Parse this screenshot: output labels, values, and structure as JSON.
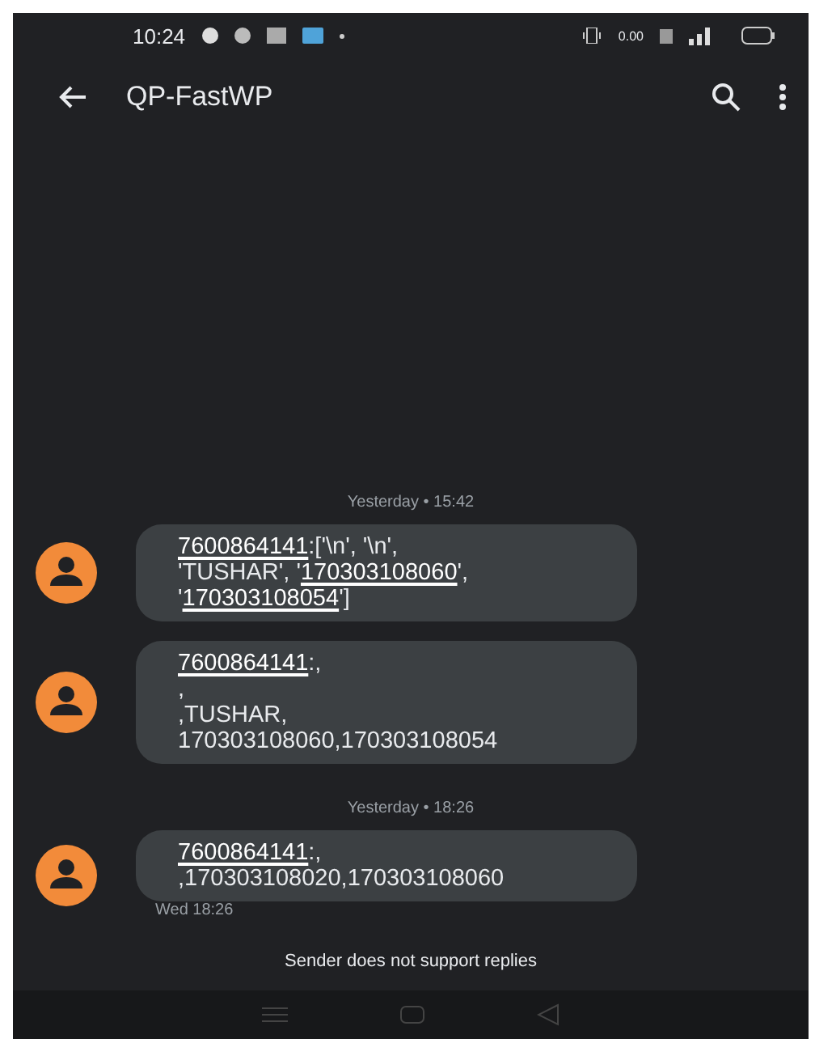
{
  "status_bar": {
    "time": "10:24",
    "speed": "0.00"
  },
  "header": {
    "title": "QP-FastWP"
  },
  "conversation": [
    {
      "kind": "date",
      "text": "Yesterday • 15:42"
    },
    {
      "kind": "message",
      "lines": [
        [
          {
            "text": "7600864141",
            "link": true
          },
          {
            "text": ":['\\n', '\\n',",
            "link": false
          }
        ],
        [
          {
            "text": "'TUSHAR', '",
            "link": false
          },
          {
            "text": "170303108060",
            "link": true
          },
          {
            "text": "',",
            "link": false
          }
        ],
        [
          {
            "text": "'",
            "link": false
          },
          {
            "text": "170303108054",
            "link": true
          },
          {
            "text": "']",
            "link": false
          }
        ]
      ]
    },
    {
      "kind": "message",
      "lines": [
        [
          {
            "text": "7600864141",
            "link": true
          },
          {
            "text": ":,",
            "link": false
          }
        ],
        [
          {
            "text": ",",
            "link": false
          }
        ],
        [
          {
            "text": ",TUSHAR,",
            "link": false
          }
        ],
        [
          {
            "text": "170303108060,170303108054",
            "link": false
          }
        ]
      ]
    },
    {
      "kind": "date",
      "text": "Yesterday • 18:26"
    },
    {
      "kind": "message",
      "lines": [
        [
          {
            "text": "7600864141",
            "link": true
          },
          {
            "text": ":,",
            "link": false
          }
        ],
        [
          {
            "text": ",170303108020,170303108060",
            "link": false
          }
        ]
      ],
      "timestamp": "Wed 18:26"
    }
  ],
  "footer": {
    "notice": "Sender does not support replies"
  }
}
